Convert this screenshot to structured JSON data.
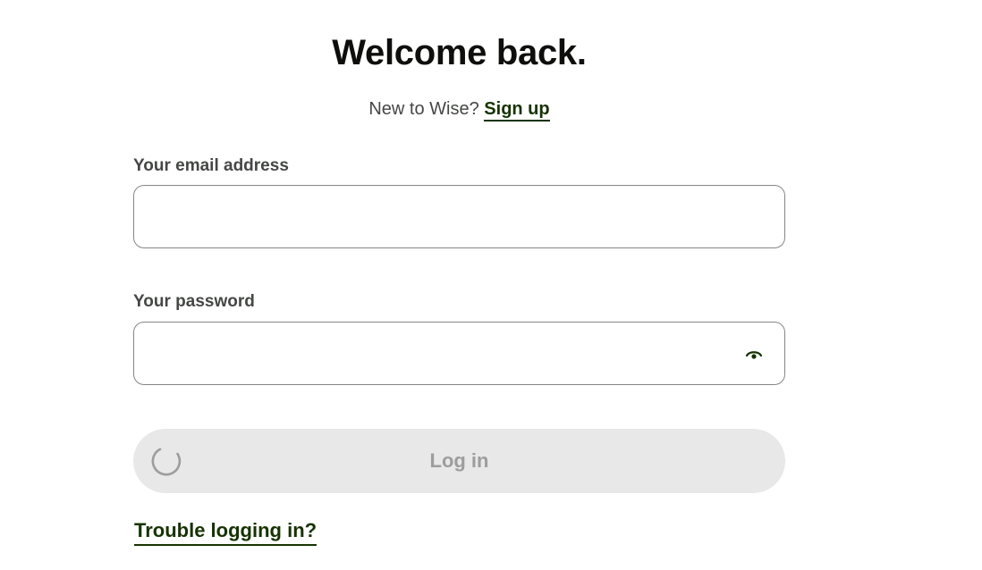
{
  "page": {
    "title": "Welcome back.",
    "signup_prompt": "New to Wise?",
    "signup_link": "Sign up"
  },
  "email": {
    "label": "Your email address",
    "value": "",
    "placeholder": ""
  },
  "password": {
    "label": "Your password",
    "value": "",
    "placeholder": "",
    "toggle_icon": "eye-icon"
  },
  "login_button": {
    "label": "Log in",
    "state": "loading",
    "spinner_icon": "loading-spinner-icon"
  },
  "trouble_link": "Trouble logging in?",
  "colors": {
    "link": "#163300",
    "title": "#0e0f0c",
    "label": "#454745",
    "input_border": "#868685",
    "button_disabled_bg": "#e8e8e8",
    "button_disabled_text": "#9d9d9d"
  }
}
